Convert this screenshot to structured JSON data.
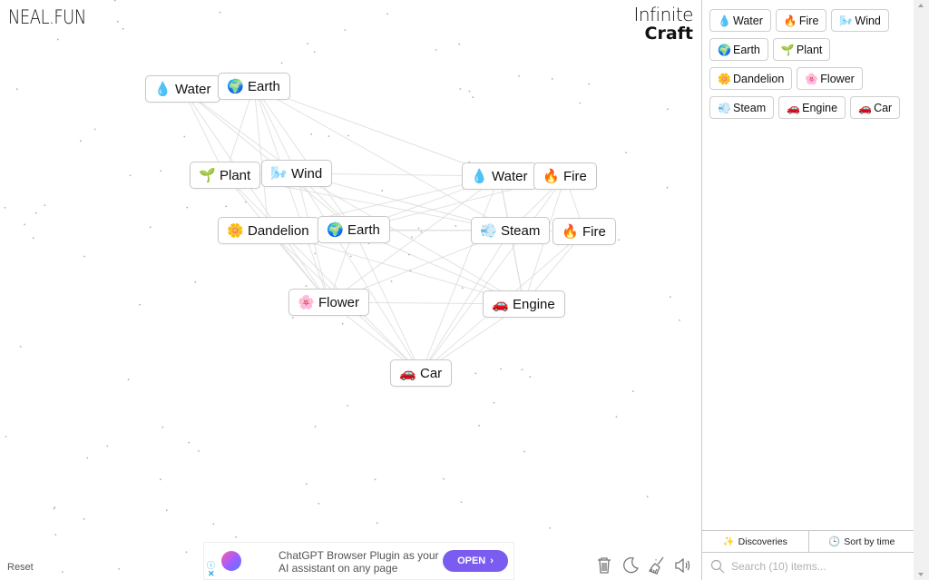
{
  "site_logo": "NEAL.FUN",
  "game_title": {
    "line1": "Infinite",
    "line2": "Craft"
  },
  "canvas": {
    "instances": [
      {
        "name": "Water",
        "emoji": "💧",
        "icon": "water-drop-icon"
      },
      {
        "name": "Earth",
        "emoji": "🌍",
        "icon": "earth-globe-icon"
      },
      {
        "name": "Plant",
        "emoji": "🌱",
        "icon": "plant-sprout-icon"
      },
      {
        "name": "Wind",
        "emoji": "🌬️",
        "icon": "wind-icon"
      },
      {
        "name": "Water",
        "emoji": "💧",
        "icon": "water-drop-icon"
      },
      {
        "name": "Fire",
        "emoji": "🔥",
        "icon": "fire-icon"
      },
      {
        "name": "Dandelion",
        "emoji": "🌼",
        "icon": "dandelion-flower-icon"
      },
      {
        "name": "Earth",
        "emoji": "🌍",
        "icon": "earth-globe-icon"
      },
      {
        "name": "Steam",
        "emoji": "💨",
        "icon": "steam-puff-icon"
      },
      {
        "name": "Fire",
        "emoji": "🔥",
        "icon": "fire-icon"
      },
      {
        "name": "Flower",
        "emoji": "🌸",
        "icon": "cherry-blossom-icon"
      },
      {
        "name": "Engine",
        "emoji": "🚗",
        "icon": "car-icon"
      },
      {
        "name": "Car",
        "emoji": "🚗",
        "icon": "car-icon"
      }
    ]
  },
  "sidebar": {
    "items": [
      {
        "name": "Water",
        "emoji": "💧",
        "icon": "water-drop-icon"
      },
      {
        "name": "Fire",
        "emoji": "🔥",
        "icon": "fire-icon"
      },
      {
        "name": "Wind",
        "emoji": "🌬️",
        "icon": "wind-icon"
      },
      {
        "name": "Earth",
        "emoji": "🌍",
        "icon": "earth-globe-icon"
      },
      {
        "name": "Plant",
        "emoji": "🌱",
        "icon": "plant-sprout-icon"
      },
      {
        "name": "Dandelion",
        "emoji": "🌼",
        "icon": "dandelion-flower-icon"
      },
      {
        "name": "Flower",
        "emoji": "🌸",
        "icon": "cherry-blossom-icon"
      },
      {
        "name": "Steam",
        "emoji": "💨",
        "icon": "steam-puff-icon"
      },
      {
        "name": "Engine",
        "emoji": "🚗",
        "icon": "car-icon"
      },
      {
        "name": "Car",
        "emoji": "🚗",
        "icon": "car-icon"
      }
    ],
    "tabs": {
      "discoveries": "Discoveries",
      "sort": "Sort by time"
    },
    "search_placeholder": "Search (10) items..."
  },
  "footer": {
    "reset": "Reset",
    "tools": [
      "trash-icon",
      "moon-icon",
      "broom-icon",
      "speaker-icon"
    ]
  },
  "ad": {
    "text": "ChatGPT Browser Plugin as your AI assistant on any page",
    "button": "OPEN",
    "info": "ⓘ",
    "close": "✕"
  },
  "colors": {
    "ad_button": "#7a5cf0",
    "border": "#c8c8c8",
    "line": "#d9d9d9"
  }
}
